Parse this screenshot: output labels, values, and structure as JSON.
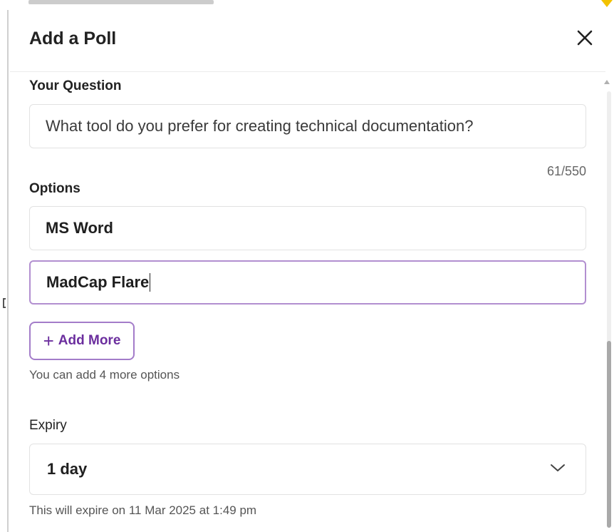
{
  "dialog": {
    "title": "Add a Poll",
    "close_icon": "close-icon"
  },
  "question": {
    "label": "Your Question",
    "value": "What tool do you prefer for creating technical documentation?",
    "counter": "61/550"
  },
  "options": {
    "label": "Options",
    "items": [
      {
        "value": "MS Word"
      },
      {
        "value": "MadCap Flare"
      }
    ],
    "add_more_icon": "plus-icon",
    "add_more_label": "Add More",
    "hint": "You can add 4 more options"
  },
  "expiry": {
    "label": "Expiry",
    "selected": "1 day",
    "dropdown_icon": "chevron-down-icon",
    "note": "This will expire on 11 Mar 2025 at 1:49 pm"
  },
  "colors": {
    "accent": "#6b2e9e",
    "accent_border": "#a37cc9",
    "focus_border": "#b28fd0",
    "marker": "#f2c200"
  }
}
